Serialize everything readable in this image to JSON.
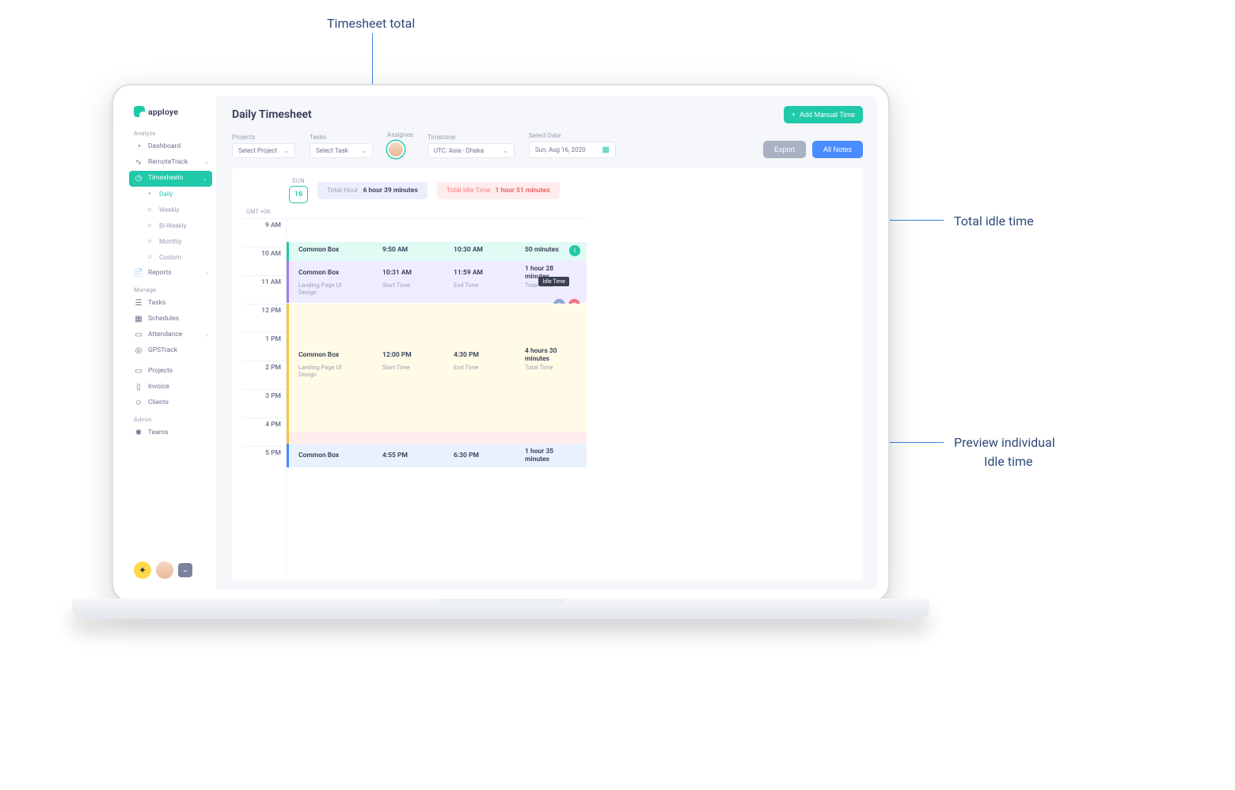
{
  "annotations": {
    "total": "Timesheet total",
    "idle": "Total idle time",
    "preview_l1": "Preview individual",
    "preview_l2": "Idle time"
  },
  "logo": "apploye",
  "sidebar": {
    "sections": {
      "analyze": "Analyze",
      "manage": "Manage",
      "admin": "Admin"
    },
    "items": {
      "dashboard": "Dashboard",
      "remotetrack": "RemoteTrack",
      "timesheets": "Timesheets",
      "daily": "Daily",
      "weekly": "Weekly",
      "biweekly": "Bi-Weekly",
      "monthly": "Monthly",
      "custom": "Custom",
      "reports": "Reports",
      "tasks": "Tasks",
      "schedules": "Schedules",
      "attendance": "Attendance",
      "gpstrack": "GPSTrack",
      "projects": "Projects",
      "invoice": "Invoice",
      "clients": "Clients",
      "teams": "Teams"
    }
  },
  "header": {
    "title": "Daily Timesheet",
    "add_manual": "Add Manual Time"
  },
  "filters": {
    "projects_label": "Projects",
    "projects_value": "Select Project",
    "tasks_label": "Tasks",
    "tasks_value": "Select Task",
    "assignee_label": "Assignee",
    "timezone_label": "Timezone",
    "timezone_value": "UTC: Asia - Dhaka",
    "date_label": "Select Date",
    "date_value": "Sun, Aug 16, 2020",
    "export": "Export",
    "notes": "All Notes"
  },
  "summary": {
    "day_label": "SUN",
    "day_num": "16",
    "total_hour_label": "Total Hour",
    "total_hour_value": "6 hour 39 minutes",
    "idle_label": "Total Idle Time",
    "idle_value": "1 hour 51 minutes",
    "gmt": "GMT +06"
  },
  "hours": [
    "9 AM",
    "10 AM",
    "11 AM",
    "12 PM",
    "1 PM",
    "2 PM",
    "3 PM",
    "4 PM",
    "5 PM"
  ],
  "entries": {
    "e1": {
      "name": "Common Box",
      "start": "9:50 AM",
      "end": "10:30 AM",
      "dur": "50 minutes"
    },
    "e2": {
      "name": "Common Box",
      "sub": "Landing Page UI Design",
      "start": "10:31 AM",
      "st": "Start Time",
      "end": "11:59 AM",
      "et": "End Time",
      "dur": "1 hour 28 minutes",
      "tt": "Total Time",
      "idle": "Idle Time"
    },
    "e3": {
      "name": "Common Box",
      "sub": "Landing Page UI Design",
      "start": "12:00 PM",
      "st": "Start Time",
      "end": "4:30 PM",
      "et": "End Time",
      "dur": "4 hours 30 minutes",
      "tt": "Total Time"
    },
    "e4": {
      "name": "Common Box",
      "start": "4:55 PM",
      "end": "6:30 PM",
      "dur": "1 hour 35 minutes"
    }
  }
}
